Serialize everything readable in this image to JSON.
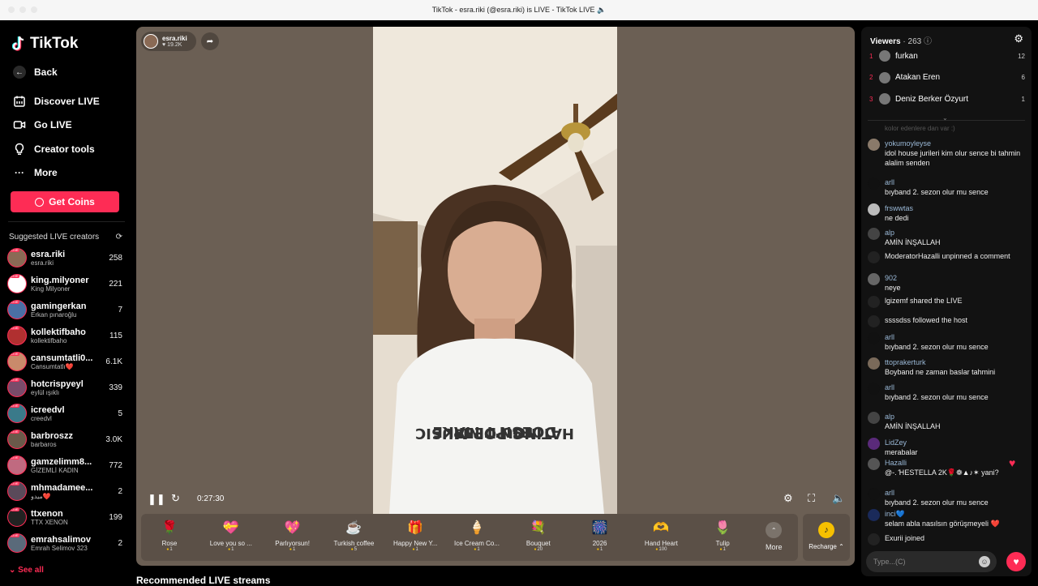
{
  "window": {
    "title": "TikTok - esra.riki (@esra.riki) is LIVE - TikTok LIVE 🔈"
  },
  "sidebar": {
    "logo": "TikTok",
    "nav": [
      {
        "label": "Back",
        "icon": "arrow-left-icon"
      },
      {
        "label": "Discover LIVE",
        "icon": "calendar-icon"
      },
      {
        "label": "Go LIVE",
        "icon": "video-camera-icon"
      },
      {
        "label": "Creator tools",
        "icon": "lightbulb-icon"
      },
      {
        "label": "More",
        "icon": "more-dots-icon"
      }
    ],
    "get_coins": "Get Coins",
    "suggested_title": "Suggested LIVE creators",
    "creators": [
      {
        "name": "esra.riki",
        "sub": "esra.riki",
        "count": "258",
        "color": "#8a6a55"
      },
      {
        "name": "king.milyoner",
        "sub": "King Milyoner",
        "count": "221",
        "color": "#ffffff"
      },
      {
        "name": "gamingerkan",
        "sub": "Erkan pınaroğlu",
        "count": "7",
        "color": "#4a6fa5"
      },
      {
        "name": "kollektifbaho",
        "sub": "kollektifbaho",
        "count": "115",
        "color": "#b03030"
      },
      {
        "name": "cansumtatli0...",
        "sub": "Cansumtatlı❤️",
        "count": "6.1K",
        "color": "#c98a6b"
      },
      {
        "name": "hotcrispyeyl",
        "sub": "eylül ışıklı",
        "count": "339",
        "color": "#7a4b6a"
      },
      {
        "name": "icreedvl",
        "sub": "creedvl",
        "count": "5",
        "color": "#3a7a8a"
      },
      {
        "name": "barbroszz",
        "sub": "barbaros",
        "count": "3.0K",
        "color": "#6a5a4a"
      },
      {
        "name": "gamzelimm8...",
        "sub": "GİZEMLİ KADIN",
        "count": "772",
        "color": "#c06a80"
      },
      {
        "name": "mhmadamee...",
        "sub": "ميدو❤️",
        "count": "2",
        "color": "#5a4a5a"
      },
      {
        "name": "ttxenon",
        "sub": "TTX XENON",
        "count": "199",
        "color": "#222222"
      },
      {
        "name": "emrahsalimov",
        "sub": "Emrah Selimov 323",
        "count": "2",
        "color": "#5a6a7a"
      }
    ],
    "see_all": "See all"
  },
  "player": {
    "host_name": "esra.riki",
    "host_likes": "19.2K",
    "time": "0:27:30",
    "gifts": [
      {
        "name": "Rose",
        "price": "1",
        "icon": "🌹"
      },
      {
        "name": "Love you so ...",
        "price": "1",
        "icon": "💝"
      },
      {
        "name": "Parlıyorsun!",
        "price": "1",
        "icon": "💖"
      },
      {
        "name": "Turkish coffee",
        "price": "5",
        "icon": "☕"
      },
      {
        "name": "Happy New Y...",
        "price": "1",
        "icon": "🎁"
      },
      {
        "name": "Ice Cream Co...",
        "price": "1",
        "icon": "🍦"
      },
      {
        "name": "Bouquet",
        "price": "20",
        "icon": "💐"
      },
      {
        "name": "2026",
        "price": "1",
        "icon": "🎆"
      },
      {
        "name": "Hand Heart",
        "price": "100",
        "icon": "🫶"
      },
      {
        "name": "Tulip",
        "price": "1",
        "icon": "🌷"
      }
    ],
    "more_label": "More",
    "recharge_label": "Recharge ⌃",
    "recommended_title": "Recommended LIVE streams"
  },
  "chat": {
    "viewers_label": "Viewers",
    "viewers_count": "· 263",
    "top": [
      {
        "rank": "1",
        "name": "furkan",
        "score": "12"
      },
      {
        "rank": "2",
        "name": "Atakan Eren",
        "score": "6"
      },
      {
        "rank": "3",
        "name": "Deniz Berker Özyurt",
        "score": "1"
      }
    ],
    "fade_text": "kolor edenlere dan var :)",
    "messages": [
      {
        "user": "yokumoyleyse",
        "text": "idol house jurileri kim olur sence bi tahmin alalim senden"
      },
      {
        "user": "arll",
        "text": "bıyband 2. sezon olur mu sence"
      },
      {
        "user": "frswwtas",
        "text": "ne dedi"
      },
      {
        "user": "alp",
        "text": "AMİN İNŞALLAH"
      },
      {
        "user": "",
        "text": "ModeratorHazalli unpinned a comment"
      },
      {
        "user": "902",
        "text": "neye"
      },
      {
        "user": "",
        "text": "lgizemf  shared the LIVE"
      },
      {
        "user": "",
        "text": "ssssdss  followed the host"
      },
      {
        "user": "arll",
        "text": "bıyband 2. sezon olur mu sence"
      },
      {
        "user": "ttoprakerturk",
        "text": "Boyband ne zaman baslar tahmini"
      },
      {
        "user": "arll",
        "text": "bıyband 2. sezon olur mu sence"
      },
      {
        "user": "alp",
        "text": "AMİN İNŞALLAH"
      },
      {
        "user": "LidZey",
        "text": "merabalar"
      },
      {
        "user": "Hazalli",
        "text": "@-. ꞪESTELLA 2K🌹❁▲♪✶ yani?"
      },
      {
        "user": "arll",
        "text": "bıyband 2. sezon olur mu sence"
      },
      {
        "user": "inci💙",
        "text": "selam abla nasılsın görüşmeyeli ❤️"
      },
      {
        "user": "",
        "text": "Exurii  joined"
      }
    ],
    "input_placeholder": "Type...(C)"
  }
}
